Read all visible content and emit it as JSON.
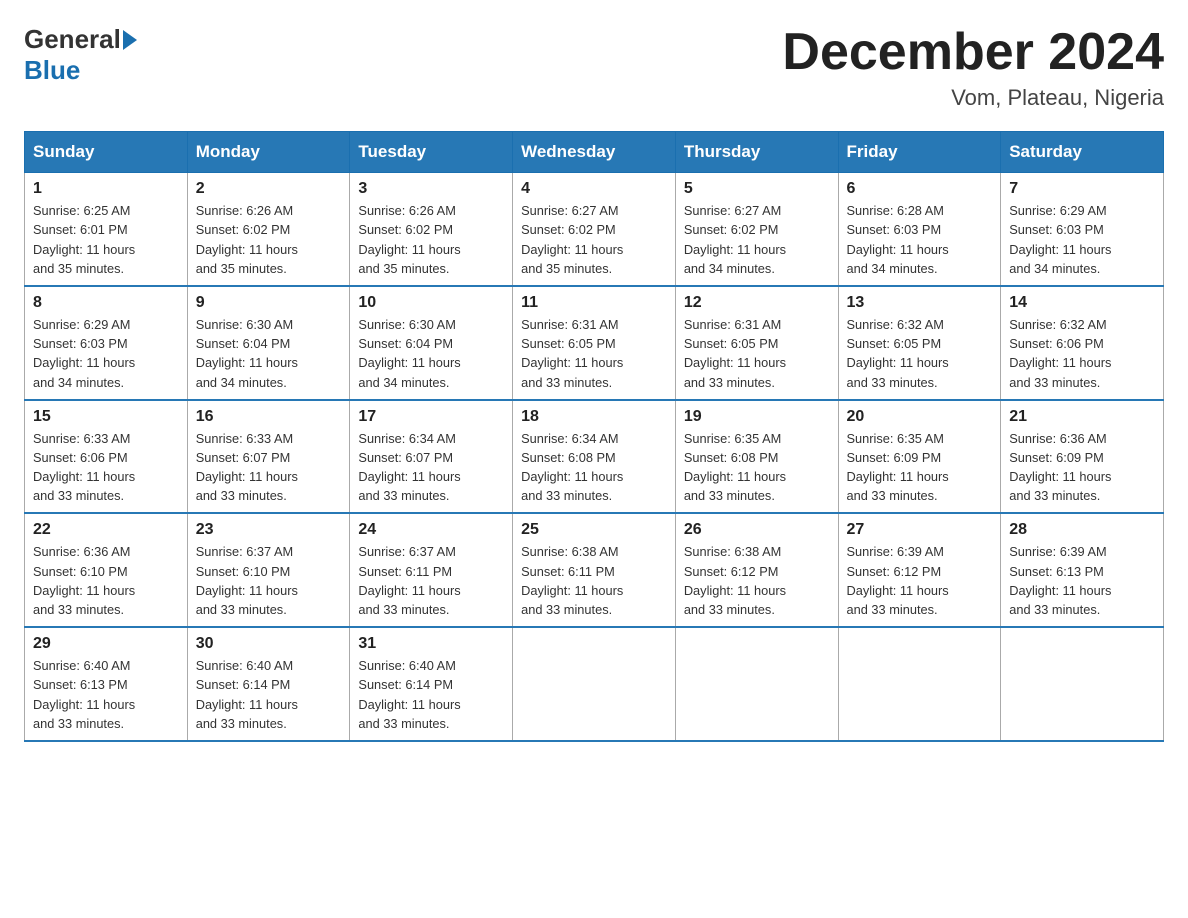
{
  "logo": {
    "general": "General",
    "blue": "Blue"
  },
  "header": {
    "month_year": "December 2024",
    "location": "Vom, Plateau, Nigeria"
  },
  "columns": [
    "Sunday",
    "Monday",
    "Tuesday",
    "Wednesday",
    "Thursday",
    "Friday",
    "Saturday"
  ],
  "weeks": [
    [
      {
        "num": "1",
        "sunrise": "6:25 AM",
        "sunset": "6:01 PM",
        "daylight": "11 hours and 35 minutes."
      },
      {
        "num": "2",
        "sunrise": "6:26 AM",
        "sunset": "6:02 PM",
        "daylight": "11 hours and 35 minutes."
      },
      {
        "num": "3",
        "sunrise": "6:26 AM",
        "sunset": "6:02 PM",
        "daylight": "11 hours and 35 minutes."
      },
      {
        "num": "4",
        "sunrise": "6:27 AM",
        "sunset": "6:02 PM",
        "daylight": "11 hours and 35 minutes."
      },
      {
        "num": "5",
        "sunrise": "6:27 AM",
        "sunset": "6:02 PM",
        "daylight": "11 hours and 34 minutes."
      },
      {
        "num": "6",
        "sunrise": "6:28 AM",
        "sunset": "6:03 PM",
        "daylight": "11 hours and 34 minutes."
      },
      {
        "num": "7",
        "sunrise": "6:29 AM",
        "sunset": "6:03 PM",
        "daylight": "11 hours and 34 minutes."
      }
    ],
    [
      {
        "num": "8",
        "sunrise": "6:29 AM",
        "sunset": "6:03 PM",
        "daylight": "11 hours and 34 minutes."
      },
      {
        "num": "9",
        "sunrise": "6:30 AM",
        "sunset": "6:04 PM",
        "daylight": "11 hours and 34 minutes."
      },
      {
        "num": "10",
        "sunrise": "6:30 AM",
        "sunset": "6:04 PM",
        "daylight": "11 hours and 34 minutes."
      },
      {
        "num": "11",
        "sunrise": "6:31 AM",
        "sunset": "6:05 PM",
        "daylight": "11 hours and 33 minutes."
      },
      {
        "num": "12",
        "sunrise": "6:31 AM",
        "sunset": "6:05 PM",
        "daylight": "11 hours and 33 minutes."
      },
      {
        "num": "13",
        "sunrise": "6:32 AM",
        "sunset": "6:05 PM",
        "daylight": "11 hours and 33 minutes."
      },
      {
        "num": "14",
        "sunrise": "6:32 AM",
        "sunset": "6:06 PM",
        "daylight": "11 hours and 33 minutes."
      }
    ],
    [
      {
        "num": "15",
        "sunrise": "6:33 AM",
        "sunset": "6:06 PM",
        "daylight": "11 hours and 33 minutes."
      },
      {
        "num": "16",
        "sunrise": "6:33 AM",
        "sunset": "6:07 PM",
        "daylight": "11 hours and 33 minutes."
      },
      {
        "num": "17",
        "sunrise": "6:34 AM",
        "sunset": "6:07 PM",
        "daylight": "11 hours and 33 minutes."
      },
      {
        "num": "18",
        "sunrise": "6:34 AM",
        "sunset": "6:08 PM",
        "daylight": "11 hours and 33 minutes."
      },
      {
        "num": "19",
        "sunrise": "6:35 AM",
        "sunset": "6:08 PM",
        "daylight": "11 hours and 33 minutes."
      },
      {
        "num": "20",
        "sunrise": "6:35 AM",
        "sunset": "6:09 PM",
        "daylight": "11 hours and 33 minutes."
      },
      {
        "num": "21",
        "sunrise": "6:36 AM",
        "sunset": "6:09 PM",
        "daylight": "11 hours and 33 minutes."
      }
    ],
    [
      {
        "num": "22",
        "sunrise": "6:36 AM",
        "sunset": "6:10 PM",
        "daylight": "11 hours and 33 minutes."
      },
      {
        "num": "23",
        "sunrise": "6:37 AM",
        "sunset": "6:10 PM",
        "daylight": "11 hours and 33 minutes."
      },
      {
        "num": "24",
        "sunrise": "6:37 AM",
        "sunset": "6:11 PM",
        "daylight": "11 hours and 33 minutes."
      },
      {
        "num": "25",
        "sunrise": "6:38 AM",
        "sunset": "6:11 PM",
        "daylight": "11 hours and 33 minutes."
      },
      {
        "num": "26",
        "sunrise": "6:38 AM",
        "sunset": "6:12 PM",
        "daylight": "11 hours and 33 minutes."
      },
      {
        "num": "27",
        "sunrise": "6:39 AM",
        "sunset": "6:12 PM",
        "daylight": "11 hours and 33 minutes."
      },
      {
        "num": "28",
        "sunrise": "6:39 AM",
        "sunset": "6:13 PM",
        "daylight": "11 hours and 33 minutes."
      }
    ],
    [
      {
        "num": "29",
        "sunrise": "6:40 AM",
        "sunset": "6:13 PM",
        "daylight": "11 hours and 33 minutes."
      },
      {
        "num": "30",
        "sunrise": "6:40 AM",
        "sunset": "6:14 PM",
        "daylight": "11 hours and 33 minutes."
      },
      {
        "num": "31",
        "sunrise": "6:40 AM",
        "sunset": "6:14 PM",
        "daylight": "11 hours and 33 minutes."
      },
      null,
      null,
      null,
      null
    ]
  ],
  "labels": {
    "sunrise": "Sunrise:",
    "sunset": "Sunset:",
    "daylight": "Daylight:"
  }
}
